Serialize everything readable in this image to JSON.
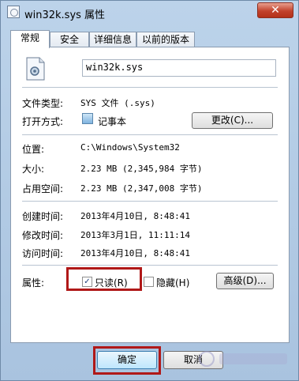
{
  "window": {
    "title": "win32k.sys 属性",
    "close_label": "✕"
  },
  "tabs": [
    {
      "label": "常规",
      "active": true
    },
    {
      "label": "安全"
    },
    {
      "label": "详细信息"
    },
    {
      "label": "以前的版本"
    }
  ],
  "file": {
    "name": "win32k.sys"
  },
  "rows": {
    "file_type": {
      "label": "文件类型:",
      "value": "SYS 文件 (.sys)"
    },
    "open_with": {
      "label": "打开方式:",
      "value": "记事本",
      "change_button": "更改(C)..."
    },
    "location": {
      "label": "位置:",
      "value": "C:\\Windows\\System32"
    },
    "size": {
      "label": "大小:",
      "value": "2.23 MB (2,345,984 字节)"
    },
    "size_on_disk": {
      "label": "占用空间:",
      "value": "2.23 MB (2,347,008 字节)"
    },
    "created": {
      "label": "创建时间:",
      "value": "2013年4月10日, 8:48:41"
    },
    "modified": {
      "label": "修改时间:",
      "value": "2013年3月1日, 11:11:14"
    },
    "accessed": {
      "label": "访问时间:",
      "value": "2013年4月10日, 8:48:41"
    }
  },
  "attributes": {
    "label": "属性:",
    "readonly": {
      "label": "只读(R)",
      "checked": true
    },
    "hidden": {
      "label": "隐藏(H)",
      "checked": false
    },
    "advanced_button": "高级(D)..."
  },
  "footer": {
    "ok": "确定",
    "cancel": "取消"
  },
  "colors": {
    "highlight": "#b01818",
    "titlebar": "#bcd3ea",
    "close": "#c2422c"
  }
}
